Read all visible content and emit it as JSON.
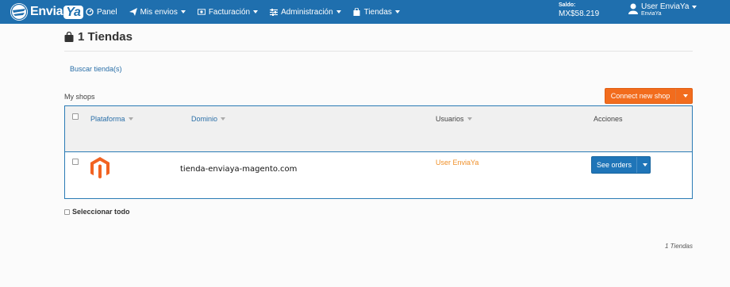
{
  "brand": {
    "name_prefix": "Envia",
    "name_suffix": "Ya"
  },
  "nav": {
    "items": [
      {
        "label": "Panel",
        "icon": "dashboard-icon",
        "has_caret": false
      },
      {
        "label": "Mis envios",
        "icon": "paper-plane-icon",
        "has_caret": true
      },
      {
        "label": "Facturación",
        "icon": "money-icon",
        "has_caret": true
      },
      {
        "label": "Administración",
        "icon": "sliders-icon",
        "has_caret": true
      },
      {
        "label": "Tiendas",
        "icon": "shopping-bag-icon",
        "has_caret": true
      }
    ],
    "saldo_label": "Saldo:",
    "saldo_value": "MX$58.219",
    "user_name": "User EnviaYa",
    "user_sub": "EnviaYa"
  },
  "page": {
    "title": "1 Tiendas",
    "search_link": "Buscar tienda(s)",
    "section_label": "My shops",
    "connect_button": "Connect new shop"
  },
  "table": {
    "headers": {
      "platform": "Plataforma",
      "domain": "Dominio",
      "users": "Usuarios",
      "actions": "Acciones"
    },
    "rows": [
      {
        "platform": "Magento",
        "domain": "tienda-enviaya-magento.com",
        "user": "User EnviaYa",
        "action": "See orders"
      }
    ]
  },
  "footer": {
    "select_all": "Seleccionar todo",
    "count": "1 Tiendas"
  },
  "colors": {
    "navbar": "#1f6fae",
    "accent_orange": "#f26c1d",
    "primary_blue": "#1f75b8",
    "magento_orange": "#f26322"
  }
}
